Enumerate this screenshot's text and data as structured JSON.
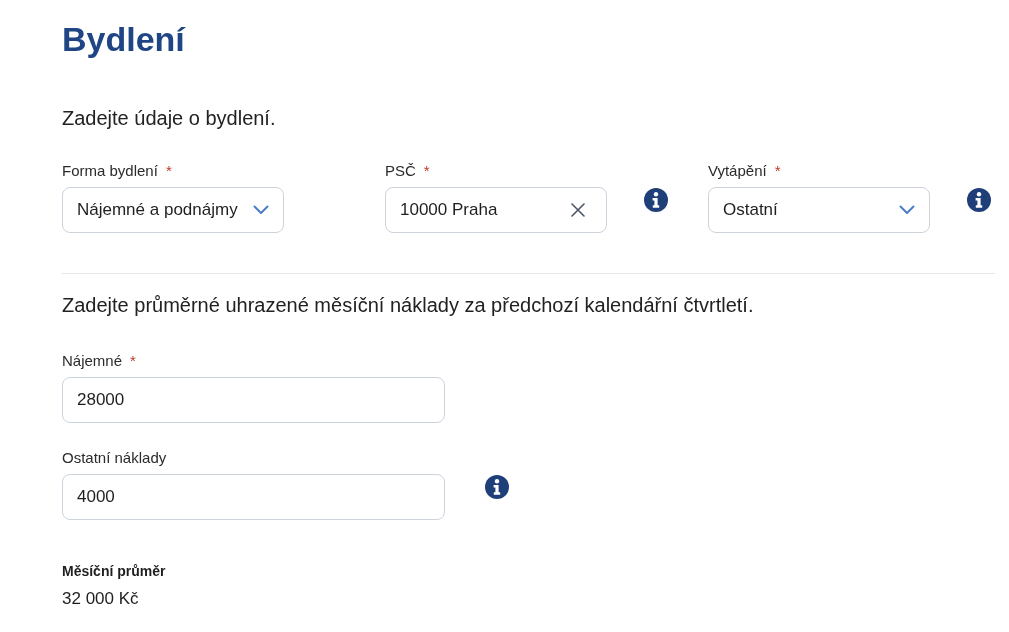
{
  "page": {
    "title": "Bydlení"
  },
  "housing_section": {
    "intro": "Zadejte údaje o bydlení.",
    "fields": [
      {
        "kind": "select",
        "label": "Forma bydlení",
        "required_mark": "*",
        "value": "Nájemné a podnájmy",
        "clearable": false,
        "info": false
      },
      {
        "kind": "text",
        "label": "PSČ",
        "required_mark": "*",
        "value": "10000 Praha",
        "clearable": true,
        "info": true
      },
      {
        "kind": "select",
        "label": "Vytápění",
        "required_mark": "*",
        "value": "Ostatní",
        "clearable": false,
        "info": true
      }
    ]
  },
  "costs_section": {
    "intro": "Zadejte průměrné uhrazené měsíční náklady za předchozí kalendářní čtvrtletí.",
    "fields": [
      {
        "kind": "text",
        "label": "Nájemné",
        "required_mark": "*",
        "value": "28000",
        "clearable": false,
        "info": false
      },
      {
        "kind": "text",
        "label": "Ostatní náklady",
        "value": "4000",
        "clearable": false,
        "info": true
      }
    ]
  },
  "summary": {
    "label": "Měsíční průměr",
    "value": "32 000 Kč"
  }
}
